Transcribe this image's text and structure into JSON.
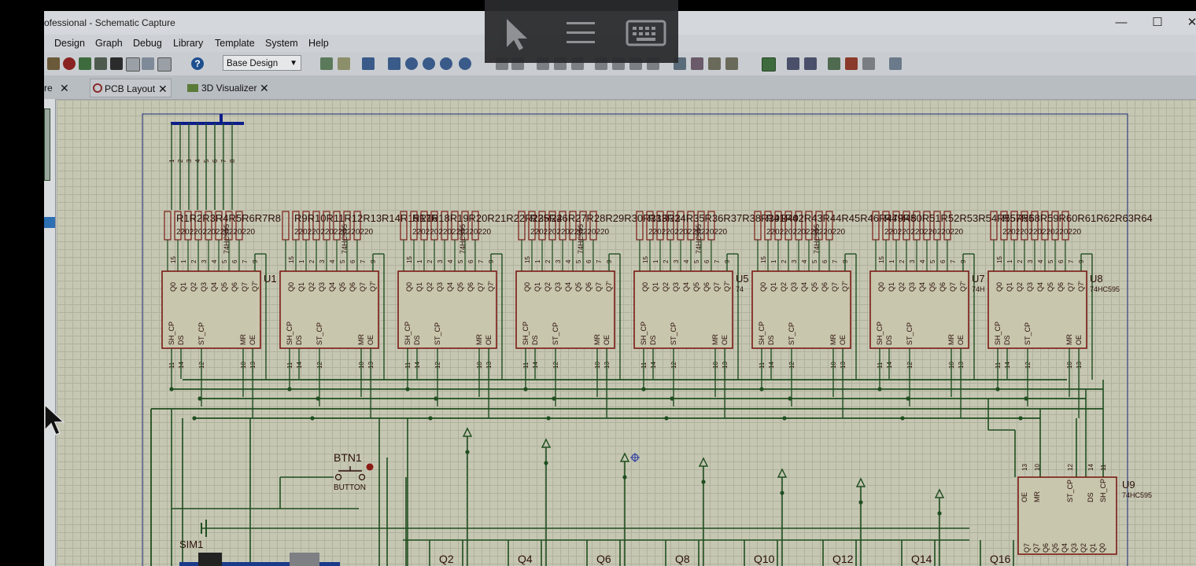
{
  "window": {
    "title": "ofessional - Schematic Capture",
    "min_glyph": "—",
    "max_glyph": "☐",
    "close_glyph": "✕"
  },
  "menu": [
    "Design",
    "Graph",
    "Debug",
    "Library",
    "Template",
    "System",
    "Help"
  ],
  "toolbar": {
    "design_select": "Base Design",
    "help_glyph": "?"
  },
  "tabs": [
    {
      "label": "re",
      "close": "✕"
    },
    {
      "label": "PCB Layout",
      "close": "✕"
    },
    {
      "label": "3D Visualizer",
      "close": "✕"
    }
  ],
  "schematic": {
    "chips": [
      {
        "ref": "U1",
        "part": ""
      },
      {
        "ref": "",
        "part": ""
      },
      {
        "ref": "",
        "part": ""
      },
      {
        "ref": "",
        "part": ""
      },
      {
        "ref": "U5",
        "part": "74"
      },
      {
        "ref": "",
        "part": ""
      },
      {
        "ref": "U7",
        "part": "74H"
      },
      {
        "ref": "U8",
        "part": "74HC595"
      }
    ],
    "top_pins": [
      "15",
      "1",
      "2",
      "3",
      "4",
      "5",
      "6",
      "7",
      "9"
    ],
    "top_pin_names": [
      "Q0",
      "Q1",
      "Q2",
      "Q3",
      "Q4",
      "Q5",
      "Q6",
      "Q7",
      "Q7'"
    ],
    "bottom_pin_names": [
      "SH_CP",
      "DS",
      "ST_CP",
      "MR",
      "OE"
    ],
    "bottom_pins": [
      "11",
      "14",
      "12",
      "10",
      "13"
    ],
    "resistor_groups": [
      "R1R2R3R4R5R6R7R8",
      "R9R10R11R12R13R14R15R16",
      "R17R18R19R20R21R22R23R24",
      "R25R26R27R28R29R30R31R32",
      "R33R34R35R36R37R38R39R40",
      "R41R42R43R44R45R46R47R48",
      "R49R50R51R52R53R54R55R56",
      "R57R58R59R60R61R62R63R64"
    ],
    "resistor_value": "220",
    "bus_pins": [
      "1",
      "2",
      "3",
      "4",
      "5",
      "6",
      "7",
      "8"
    ],
    "side_part_label": "74HC595",
    "u9": {
      "ref": "U9",
      "part": "74HC595",
      "top_pins": [
        "13",
        "10",
        "12",
        "14",
        "11"
      ],
      "pin_names": [
        "OE",
        "MR",
        "ST_CP",
        "DS",
        "SH_CP"
      ],
      "bottom_names": [
        "Q7",
        "Q7",
        "Q6",
        "Q5",
        "Q4",
        "Q3",
        "Q2",
        "Q1",
        "Q0"
      ]
    },
    "button": {
      "ref": "BTN1",
      "type": "BUTTON"
    },
    "sim": {
      "ref": "SIM1"
    },
    "transistors": [
      "Q2",
      "Q4",
      "Q6",
      "Q8",
      "Q10",
      "Q12",
      "Q14",
      "Q16"
    ]
  },
  "colors": {
    "wire": "#1f4e1f",
    "chip_border": "#7a1a14",
    "chip_fill": "#c8c6ad",
    "bus": "#0d1e8a",
    "sheet_border": "#1f2d7a",
    "text": "#2b0e0a"
  }
}
